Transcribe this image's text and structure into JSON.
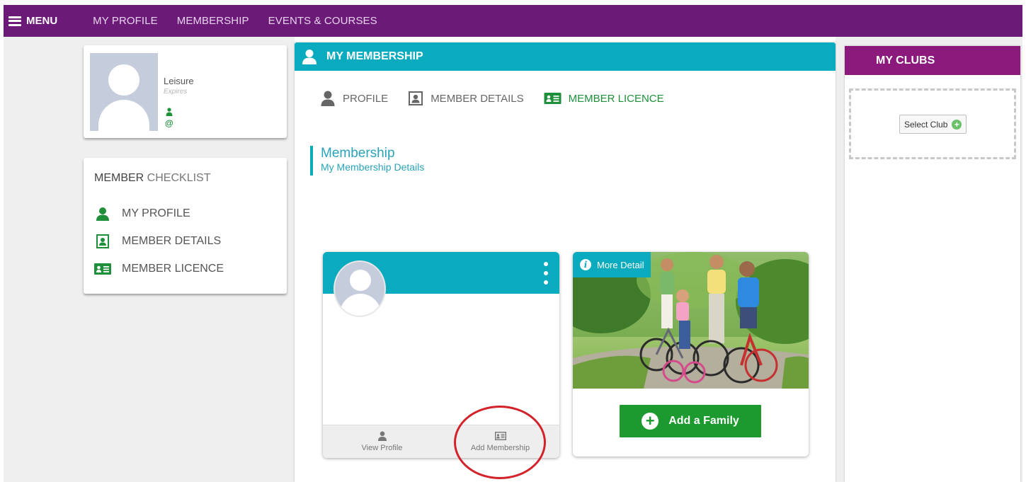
{
  "nav": {
    "menu_label": "MENU",
    "links": [
      "MY PROFILE",
      "MEMBERSHIP",
      "EVENTS & COURSES"
    ]
  },
  "profile": {
    "membership_type": "Leisure",
    "expires_label": "Expires",
    "email_symbol": "@"
  },
  "checklist": {
    "title_bold": "MEMBER",
    "title_rest": " CHECKLIST",
    "items": [
      "MY PROFILE",
      "MEMBER DETAILS",
      "MEMBER LICENCE"
    ]
  },
  "main": {
    "header_title": "MY MEMBERSHIP",
    "tabs": [
      "PROFILE",
      "MEMBER DETAILS",
      "MEMBER LICENCE"
    ],
    "section_title": "Membership",
    "section_subtitle": "My Membership Details"
  },
  "member_card": {
    "view_profile_label": "View Profile",
    "add_membership_label": "Add Membership"
  },
  "family_card": {
    "more_detail_label": "More Detail",
    "add_family_label": "Add a Family",
    "info_glyph": "i",
    "plus_glyph": "+"
  },
  "clubs": {
    "header_title": "MY CLUBS",
    "select_club_label": "Select Club",
    "plus_glyph": "+"
  },
  "colors": {
    "nav_bg": "#6b1a77",
    "teal": "#0aaabf",
    "green": "#1d9a2f",
    "clubs_header": "#8b1a7c",
    "annotation_red": "#d3222a"
  }
}
